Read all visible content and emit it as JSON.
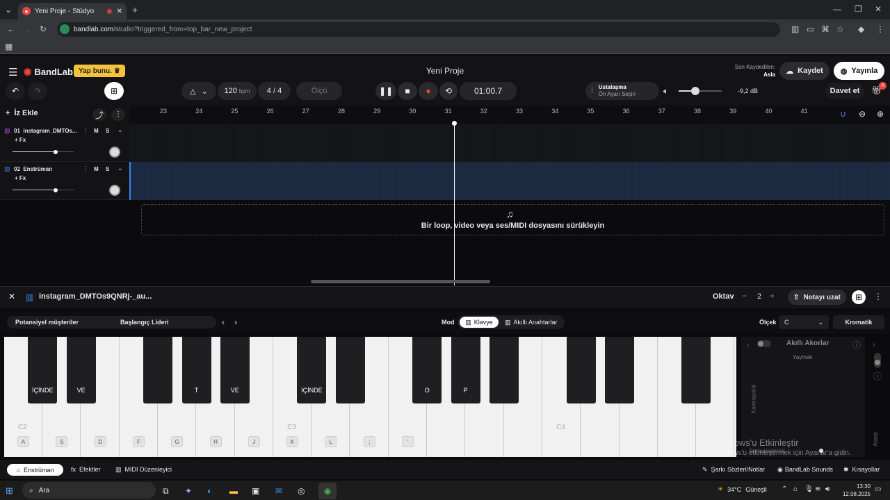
{
  "browser": {
    "tab_title": "Yeni Proje - Stüdyo",
    "url_domain": "bandlab.com",
    "url_path": "/studio?triggered_from=top_bar_new_project"
  },
  "header": {
    "logo": "BandLab",
    "promo": "Yap bunu.",
    "project_title": "Yeni Proje",
    "last_saved_label": "Son Kaydedilen:",
    "last_saved_value": "Asla",
    "save_label": "Kaydet",
    "publish_label": "Yayınla",
    "invite_label": "Davet et",
    "invite_badge": "4"
  },
  "transport": {
    "bpm": "120",
    "bpm_unit": "bpm",
    "time_sig": "4 / 4",
    "measure_label": "Ölçü",
    "time": "01:00.7",
    "mastering_title": "Ustalaşma",
    "mastering_sub": "Ön Ayarı Seçin",
    "volume_db": "-9,2 dB",
    "volume_level": 0.38
  },
  "tracks": {
    "add_label": "İz Ekle",
    "fx_label": "+ Fx",
    "mute": "M",
    "solo": "S",
    "items": [
      {
        "name": "01  instagram_DMTOs...",
        "color": "#a855f7",
        "volume": 0.7
      },
      {
        "name": "02  Enstrüman",
        "color": "#3b82f6",
        "volume": 0.7
      }
    ]
  },
  "ruler": [
    "23",
    "24",
    "25",
    "26",
    "27",
    "28",
    "29",
    "30",
    "31",
    "32",
    "33",
    "34",
    "35",
    "36",
    "37",
    "38",
    "39",
    "40",
    "41"
  ],
  "dropzone": "Bir loop, video veya ses/MIDI dosyasını sürükleyin",
  "editor": {
    "track_name": "instagram_DMTOs9QNRj-_au...",
    "octave_label": "Oktav",
    "octave_value": "2",
    "sustain_label": "Notayı uzat",
    "preset_left": "Potansiyel müşteriler",
    "preset_right": "Başlangıç Lideri",
    "mode_label": "Mod",
    "mode_keyboard": "Klavye",
    "mode_smart": "Akıllı Anahtarlar",
    "scale_label": "Ölçek",
    "scale_value": "C",
    "scale_type": "Kromatik",
    "smart_chords": "Akıllı Akorlar",
    "smart_chords_sub": "Yaymak",
    "complexity": "Karmaşıklık",
    "arpeggio": "Arpeji",
    "spread": "Tempo/adımlık"
  },
  "piano": {
    "octave_marks": [
      "C2",
      "C3",
      "C4"
    ],
    "white_keycaps": [
      "A",
      "S",
      "D",
      "F",
      "G",
      "H",
      "J",
      "K",
      "L",
      ";",
      "'"
    ],
    "black_labels": [
      "İÇİNDE",
      "VE",
      "",
      "T",
      "VE",
      "İÇİNDE",
      "",
      "O",
      "P",
      "",
      "",
      "",
      "",
      "",
      "",
      ""
    ]
  },
  "bottom": {
    "tab_instrument": "Enstrüman",
    "tab_effects": "Efektler",
    "tab_midi": "MIDI Düzenleyici",
    "lyrics": "Şarkı Sözleri/Notlar",
    "sounds": "BandLab Sounds",
    "shortcuts": "Kısayollar"
  },
  "watermark": {
    "line1": "Windows'u Etkinleştir",
    "line2": "Windows'u etkinleştirmek için Ayarlar'a gidin."
  },
  "taskbar": {
    "search": "Ara",
    "weather": "34°C",
    "weather_desc": "Güneşli",
    "time": "13:30",
    "date": "12.08.2025"
  }
}
